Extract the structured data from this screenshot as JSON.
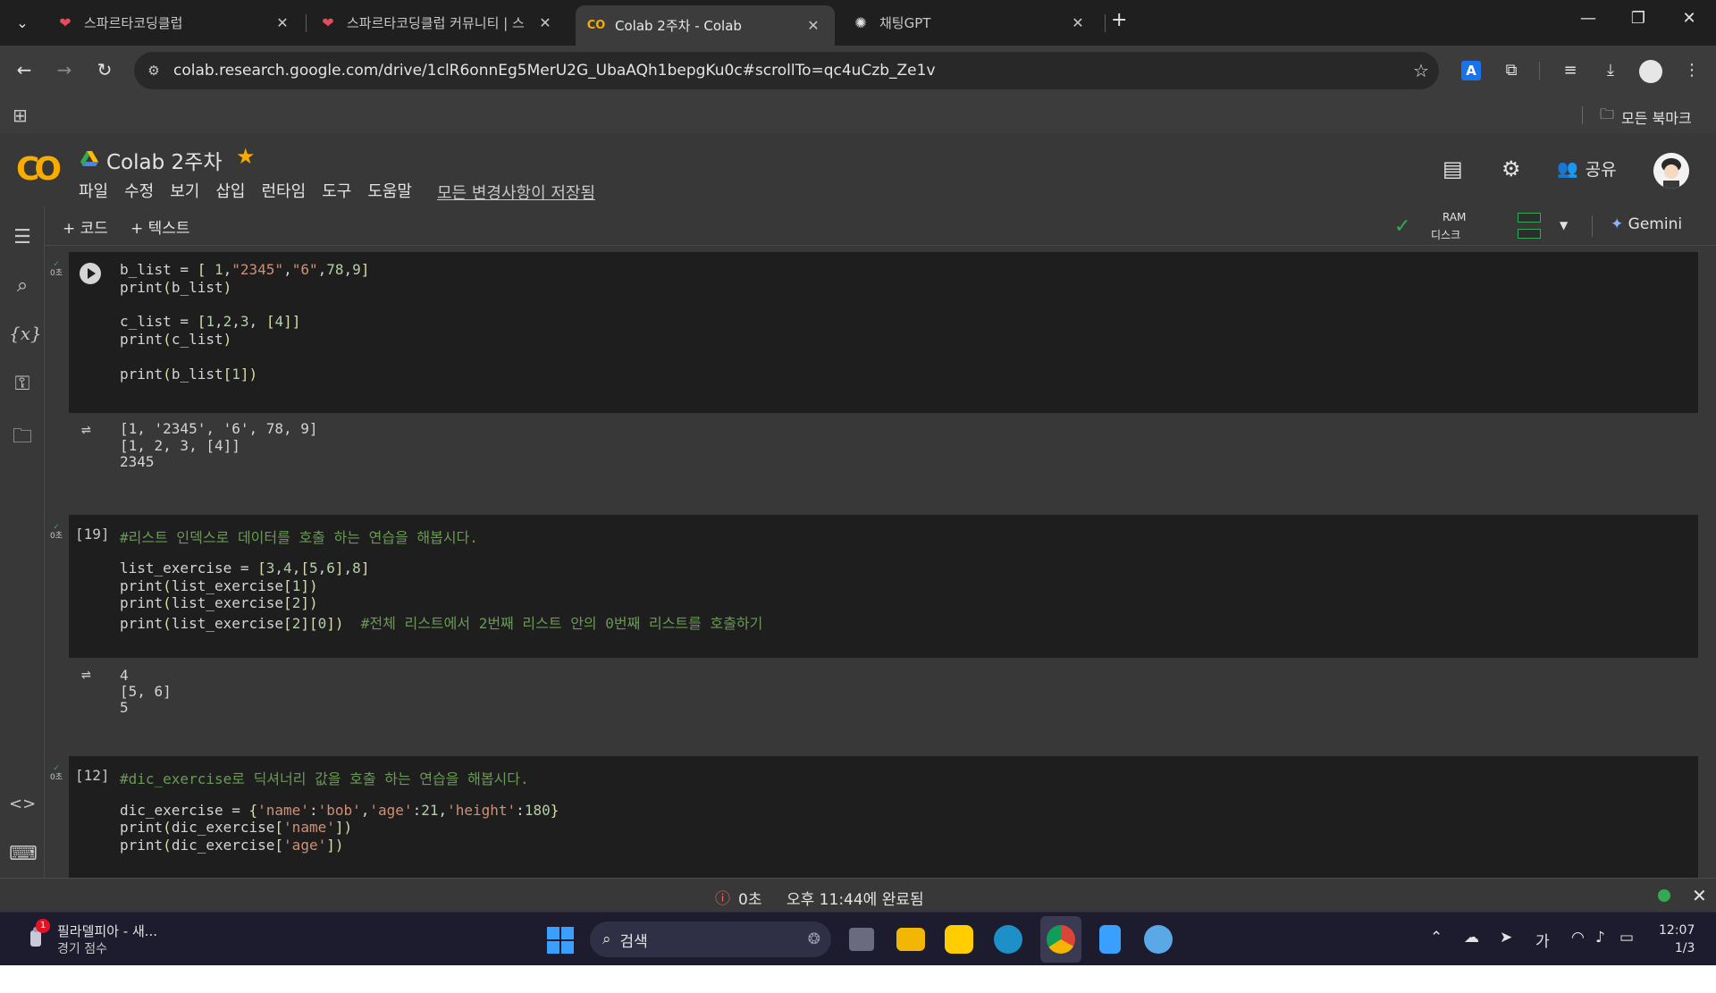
{
  "browser": {
    "tabs": [
      {
        "title": "스파르타코딩클럽",
        "active": false
      },
      {
        "title": "스파르타코딩클럽 커뮤니티 | 스",
        "active": false
      },
      {
        "title": "Colab 2주차 - Colab",
        "active": true
      },
      {
        "title": "채팅GPT",
        "active": false
      }
    ],
    "url": "colab.research.google.com/drive/1clR6onnEg5MerU2G_UbaAQh1bepgKu0c#scrollTo=qc4uCzb_Ze1v",
    "bookmarks_all": "모든 북마크"
  },
  "colab": {
    "title": "Colab 2주차",
    "menu": [
      "파일",
      "수정",
      "보기",
      "삽입",
      "런타임",
      "도구",
      "도움말"
    ],
    "saved_status": "모든 변경사항이 저장됨",
    "share_label": "공유",
    "toolbar": {
      "add_code": "+ 코드",
      "add_text": "+ 텍스트",
      "ram_label": "RAM",
      "disk_label": "디스크",
      "gemini_label": "Gemini"
    }
  },
  "cells": [
    {
      "exec_count": "",
      "exec_time": "0초",
      "code": [
        "b_list = [ 1,\"2345\",\"6\",78,9]",
        "print(b_list)",
        "",
        "c_list = [1,2,3, [4]]",
        "print(c_list)",
        "",
        "print(b_list[1])"
      ],
      "output": [
        "[1, '2345', '6', 78, 9]",
        "[1, 2, 3, [4]]",
        "2345"
      ]
    },
    {
      "exec_count": "[19]",
      "exec_time": "0초",
      "code": [
        "#리스트 인덱스로 데이터를 호출 하는 연습을 해봅시다.",
        "",
        "list_exercise = [3,4,[5,6],8]",
        "print(list_exercise[1])",
        "print(list_exercise[2])",
        "print(list_exercise[2][0])  #전체 리스트에서 2번째 리스트 안의 0번째 리스트를 호출하기"
      ],
      "output": [
        "4",
        "[5, 6]",
        "5"
      ]
    },
    {
      "exec_count": "[12]",
      "exec_time": "0초",
      "code": [
        "#dic_exercise로 딕셔너리 값을 호출 하는 연습을 해봅시다.",
        "",
        "dic_exercise = {'name':'bob','age':21,'height':180}",
        "print(dic_exercise['name'])",
        "print(dic_exercise['age'])"
      ],
      "output": []
    }
  ],
  "statusbar": {
    "duration": "0초",
    "completed": "오후 11:44에 완료됨"
  },
  "taskbar": {
    "weather_title": "필라델피아 - 새...",
    "weather_sub": "경기 점수",
    "badge": "1",
    "search_label": "검색",
    "ime": "가",
    "time": "12:07",
    "date": "1/3"
  },
  "colors": {
    "colab_orange": "#f9ab00",
    "success_green": "#34a853",
    "error_red": "#ee675c",
    "code_bg": "#1e1e1e",
    "panel_bg": "#383838"
  }
}
